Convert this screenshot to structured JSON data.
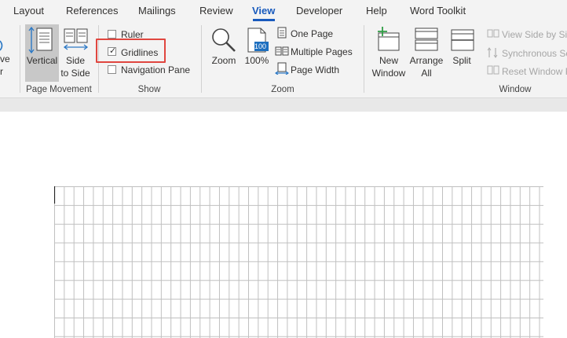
{
  "tabs": [
    "Layout",
    "References",
    "Mailings",
    "Review",
    "View",
    "Developer",
    "Help",
    "Word Toolkit"
  ],
  "active_tab": "View",
  "ribbon": {
    "edge_fragment": [
      "ve",
      "r"
    ],
    "page_movement": {
      "vertical_label": "Vertical",
      "side_label": [
        "Side",
        "to Side"
      ],
      "group_label": "Page Movement"
    },
    "show": {
      "ruler_label": "Ruler",
      "ruler_checked": false,
      "gridlines_label": "Gridlines",
      "gridlines_checked": true,
      "nav_pane_label": "Navigation Pane",
      "nav_pane_checked": false,
      "group_label": "Show"
    },
    "zoom": {
      "zoom_label": "Zoom",
      "hundred_label": "100%",
      "hundred_icon_text": "100",
      "one_page_label": "One Page",
      "multiple_pages_label": "Multiple Pages",
      "page_width_label": "Page Width",
      "group_label": "Zoom"
    },
    "window": {
      "new_window_label": [
        "New",
        "Window"
      ],
      "arrange_all_label": [
        "Arrange",
        "All"
      ],
      "split_label": "Split",
      "view_side_by_side_label": "View Side by Sic",
      "synchronous_label": "Synchronous Sc",
      "reset_window_label": "Reset Window P",
      "group_label": "Window"
    }
  },
  "colors": {
    "accent": "#185abd",
    "highlight": "#e0463f",
    "ribbon_bg": "#f3f3f3",
    "gridline": "#c0c0c0"
  },
  "icons": [
    "vertical-scroll-icon",
    "side-to-side-icon",
    "magnifier-icon",
    "hundred-percent-icon",
    "one-page-icon",
    "multiple-pages-icon",
    "page-width-icon",
    "new-window-icon",
    "arrange-all-icon",
    "split-icon",
    "view-side-by-side-icon",
    "synchronous-scrolling-icon",
    "reset-window-position-icon"
  ]
}
